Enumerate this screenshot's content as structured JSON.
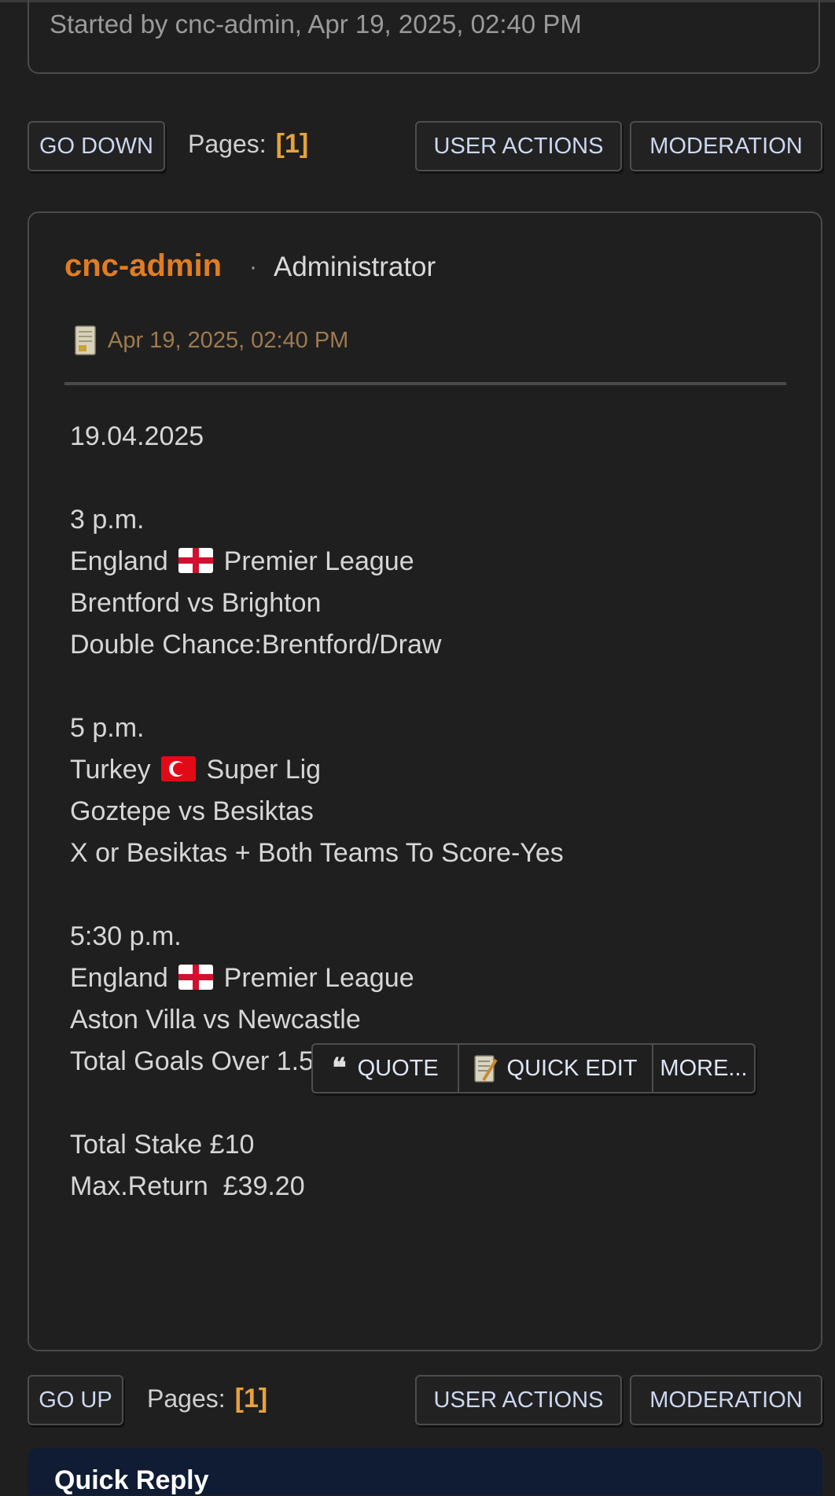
{
  "topic": {
    "started_by": "Started by cnc-admin, Apr 19, 2025, 02:40 PM"
  },
  "nav_top": {
    "go_label": "GO DOWN",
    "pages_label": "Pages:",
    "page_current": "[1]",
    "user_actions": "USER ACTIONS",
    "moderation": "MODERATION"
  },
  "post": {
    "author": "cnc-admin",
    "separator": "·",
    "role": "Administrator",
    "date": "Apr 19, 2025, 02:40 PM",
    "lines": {
      "l0": "19.04.2025",
      "l1": "",
      "l2": "3 p.m.",
      "l3a": "England ",
      "l3b": " Premier League",
      "l4": "Brentford vs Brighton",
      "l5": "Double Chance:Brentford/Draw",
      "l6": "",
      "l7": "5 p.m.",
      "l8a": "Turkey ",
      "l8b": " Super Lig",
      "l9": "Goztepe vs Besiktas",
      "l10": "X or Besiktas + Both Teams To Score-Yes",
      "l11": "",
      "l12": "5:30 p.m.",
      "l13a": "England ",
      "l13b": " Premier League",
      "l14": "Aston Villa vs Newcastle",
      "l15": "Total Goals Over 1.5",
      "l16": "",
      "l17": "Total Stake £10",
      "l18": "Max.Return  £39.20"
    },
    "actions": {
      "quote": "QUOTE",
      "quick_edit": "QUICK EDIT",
      "more": "MORE..."
    }
  },
  "nav_bottom": {
    "go_label": "GO UP",
    "pages_label": "Pages:",
    "page_current": "[1]",
    "user_actions": "USER ACTIONS",
    "moderation": "MODERATION"
  },
  "quick_reply": {
    "title": "Quick Reply"
  }
}
